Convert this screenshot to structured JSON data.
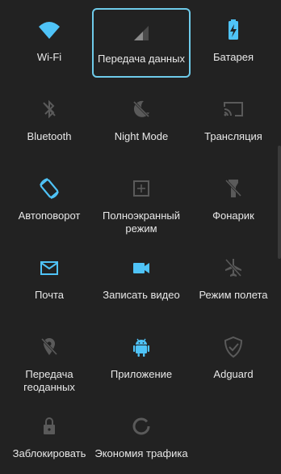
{
  "colors": {
    "background": "#222222",
    "accent": "#4fc3f7",
    "inactive_icon": "#5a5a5a",
    "label": "#e8e8e8",
    "selection_border": "#6ecbea"
  },
  "tiles": [
    {
      "label": "Wi-Fi",
      "icon": "wifi-icon",
      "active": true
    },
    {
      "label": "Передача данных",
      "icon": "cellular-signal-icon",
      "active": false,
      "selected": true
    },
    {
      "label": "Батарея",
      "icon": "battery-charging-icon",
      "active": true
    },
    {
      "label": "Bluetooth",
      "icon": "bluetooth-off-icon",
      "active": false
    },
    {
      "label": "Night Mode",
      "icon": "night-mode-off-icon",
      "active": false
    },
    {
      "label": "Трансляция",
      "icon": "cast-icon",
      "active": false
    },
    {
      "label": "Автоповорот",
      "icon": "auto-rotate-icon",
      "active": true
    },
    {
      "label": "Полноэкранный\nрежим",
      "icon": "fullscreen-icon",
      "active": false
    },
    {
      "label": "Фонарик",
      "icon": "flashlight-off-icon",
      "active": false
    },
    {
      "label": "Почта",
      "icon": "mail-icon",
      "active": true
    },
    {
      "label": "Записать видео",
      "icon": "video-camera-icon",
      "active": true
    },
    {
      "label": "Режим полета",
      "icon": "airplane-off-icon",
      "active": false
    },
    {
      "label": "Передача\nгеоданных",
      "icon": "location-off-icon",
      "active": false
    },
    {
      "label": "Приложение",
      "icon": "android-icon",
      "active": true
    },
    {
      "label": "Adguard",
      "icon": "adguard-shield-icon",
      "active": false
    },
    {
      "label": "Заблокировать",
      "icon": "lock-icon",
      "active": false
    },
    {
      "label": "Экономия трафика",
      "icon": "data-saver-icon",
      "active": false
    }
  ]
}
